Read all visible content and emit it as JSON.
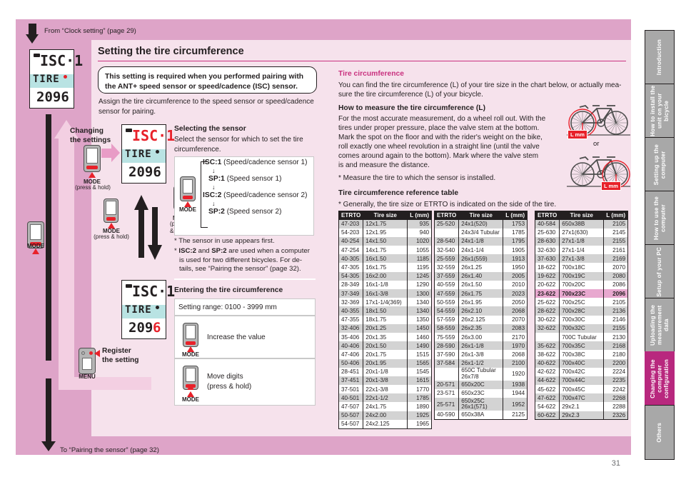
{
  "page": {
    "number": "31"
  },
  "flow": {
    "from_label": "From “Clock setting” (page 29)",
    "to_label": "To “Pairing the sensor” (page 32)",
    "changing_the_settings": "Changing\nthe settings",
    "mode_label": "MODE",
    "menu_label": "MENU",
    "press_hold": "(press & hold)",
    "press_hold_two_line": "(press\n& hold)",
    "register_setting": "Register\nthe setting"
  },
  "lcd": {
    "top_text": "ISC·1",
    "mid_text": "TIRE",
    "value": "2096",
    "value_head": "209",
    "value_tail": "6"
  },
  "main": {
    "title": "Setting the tire circumference",
    "callout": "This setting is required when you performed pairing with the ANT+ speed sensor or speed/cadence (ISC) sensor.",
    "intro": "Assign the tire circumference to the speed sensor or speed/cadence sensor for pairing."
  },
  "selecting_sensor": {
    "heading": "Selecting the sensor",
    "desc": "Select the sensor for which to set the tire circumference.",
    "items": [
      {
        "code": "ISC:1",
        "desc": "(Speed/cadence sensor 1)"
      },
      {
        "code": "SP:1",
        "desc": "(Speed sensor 1)"
      },
      {
        "code": "ISC:2",
        "desc": "(Speed/cadence sensor 2)"
      },
      {
        "code": "SP:2",
        "desc": "(Speed sensor 2)"
      }
    ],
    "note1": "* The sensor in use appears first.",
    "note2": "* ISC:2 and SP:2 are used when a computer is used for two different bicycles. For de-tails, see “Pairing the sensor” (page 32).",
    "note2_parts": {
      "a": "* ",
      "b": "ISC:2",
      "c": " and ",
      "d": "SP:2",
      "e": " are used when a computer"
    },
    "note2_line2": "is used for two different bicycles. For de-",
    "note2_line3": "tails, see “Pairing the sensor” (page 32)."
  },
  "entering": {
    "heading": "Entering the tire circumference",
    "range": "Setting range: 0100 - 3999 mm",
    "rows": [
      {
        "label": "Increase the value",
        "button": "MODE"
      },
      {
        "label": "Move digits\n(press & hold)",
        "button": "MODE"
      }
    ]
  },
  "right_col": {
    "h1": "Tire circumference",
    "p1_l1": "You can find the tire circumference (L) of your tire size in the chart below, or actually mea-",
    "p1_l2": "sure the tire circumference (L) of your bicycle.",
    "h2": "How to measure the tire circumference (L)",
    "p2_l1": "For the most accurate measurement, do a wheel roll out. With the",
    "p2_l2": "tires under proper pressure, place the valve stem at the bottom.",
    "p2_l3": "Mark the spot on the floor and with the rider's weight on the bike,",
    "p2_l4": "roll exactly one wheel revolution in a straight line (until the valve",
    "p2_l5": "comes around again to the bottom). Mark where the valve stem",
    "p2_l6": "is and measure the distance.",
    "p3": "* Measure the tire to which the sensor is installed.",
    "h3": "Tire circumference reference table",
    "p4": "* Generally, the tire size or ETRTO is indicated on the side of the tire.",
    "or": "or",
    "lmm": "L mm"
  },
  "table": {
    "headers": [
      "ETRTO",
      "Tire size",
      "L (mm)"
    ],
    "highlight_row": "23-622",
    "col1": [
      [
        "47-203",
        "12x1.75",
        "935"
      ],
      [
        "54-203",
        "12x1.95",
        "940"
      ],
      [
        "40-254",
        "14x1.50",
        "1020"
      ],
      [
        "47-254",
        "14x1.75",
        "1055"
      ],
      [
        "40-305",
        "16x1.50",
        "1185"
      ],
      [
        "47-305",
        "16x1.75",
        "1195"
      ],
      [
        "54-305",
        "16x2.00",
        "1245"
      ],
      [
        "28-349",
        "16x1-1/8",
        "1290"
      ],
      [
        "37-349",
        "16x1-3/8",
        "1300"
      ],
      [
        "32-369",
        "17x1-1/4(369)",
        "1340"
      ],
      [
        "40-355",
        "18x1.50",
        "1340"
      ],
      [
        "47-355",
        "18x1.75",
        "1350"
      ],
      [
        "32-406",
        "20x1.25",
        "1450"
      ],
      [
        "35-406",
        "20x1.35",
        "1460"
      ],
      [
        "40-406",
        "20x1.50",
        "1490"
      ],
      [
        "47-406",
        "20x1.75",
        "1515"
      ],
      [
        "50-406",
        "20x1.95",
        "1565"
      ],
      [
        "28-451",
        "20x1-1/8",
        "1545"
      ],
      [
        "37-451",
        "20x1-3/8",
        "1615"
      ],
      [
        "37-501",
        "22x1-3/8",
        "1770"
      ],
      [
        "40-501",
        "22x1-1/2",
        "1785"
      ],
      [
        "47-507",
        "24x1.75",
        "1890"
      ],
      [
        "50-507",
        "24x2.00",
        "1925"
      ],
      [
        "54-507",
        "24x2.125",
        "1965"
      ]
    ],
    "col2": [
      [
        "25-520",
        "24x1(520)",
        "1753"
      ],
      [
        "",
        "24x3/4 Tubular",
        "1785"
      ],
      [
        "28-540",
        "24x1-1/8",
        "1795"
      ],
      [
        "32-540",
        "24x1-1/4",
        "1905"
      ],
      [
        "25-559",
        "26x1(559)",
        "1913"
      ],
      [
        "32-559",
        "26x1.25",
        "1950"
      ],
      [
        "37-559",
        "26x1.40",
        "2005"
      ],
      [
        "40-559",
        "26x1.50",
        "2010"
      ],
      [
        "47-559",
        "26x1.75",
        "2023"
      ],
      [
        "50-559",
        "26x1.95",
        "2050"
      ],
      [
        "54-559",
        "26x2.10",
        "2068"
      ],
      [
        "57-559",
        "26x2.125",
        "2070"
      ],
      [
        "58-559",
        "26x2.35",
        "2083"
      ],
      [
        "75-559",
        "26x3.00",
        "2170"
      ],
      [
        "28-590",
        "26x1-1/8",
        "1970"
      ],
      [
        "37-590",
        "26x1-3/8",
        "2068"
      ],
      [
        "37-584",
        "26x1-1/2",
        "2100"
      ],
      [
        "",
        "650C Tubular\n26x7/8",
        "1920"
      ],
      [
        "20-571",
        "650x20C",
        "1938"
      ],
      [
        "23-571",
        "650x23C",
        "1944"
      ],
      [
        "25-571",
        "650x25C\n26x1(571)",
        "1952"
      ],
      [
        "40-590",
        "650x38A",
        "2125"
      ]
    ],
    "col3": [
      [
        "40-584",
        "650x38B",
        "2105"
      ],
      [
        "25-630",
        "27x1(630)",
        "2145"
      ],
      [
        "28-630",
        "27x1-1/8",
        "2155"
      ],
      [
        "32-630",
        "27x1-1/4",
        "2161"
      ],
      [
        "37-630",
        "27x1-3/8",
        "2169"
      ],
      [
        "18-622",
        "700x18C",
        "2070"
      ],
      [
        "19-622",
        "700x19C",
        "2080"
      ],
      [
        "20-622",
        "700x20C",
        "2086"
      ],
      [
        "23-622",
        "700x23C",
        "2096"
      ],
      [
        "25-622",
        "700x25C",
        "2105"
      ],
      [
        "28-622",
        "700x28C",
        "2136"
      ],
      [
        "30-622",
        "700x30C",
        "2146"
      ],
      [
        "32-622",
        "700x32C",
        "2155"
      ],
      [
        "",
        "700C Tubular",
        "2130"
      ],
      [
        "35-622",
        "700x35C",
        "2168"
      ],
      [
        "38-622",
        "700x38C",
        "2180"
      ],
      [
        "40-622",
        "700x40C",
        "2200"
      ],
      [
        "42-622",
        "700x42C",
        "2224"
      ],
      [
        "44-622",
        "700x44C",
        "2235"
      ],
      [
        "45-622",
        "700x45C",
        "2242"
      ],
      [
        "47-622",
        "700x47C",
        "2268"
      ],
      [
        "54-622",
        "29x2.1",
        "2288"
      ],
      [
        "60-622",
        "29x2.3",
        "2326"
      ]
    ]
  },
  "index_tabs": [
    {
      "label": "Introduction",
      "active": false
    },
    {
      "label": "How to install the\nunit on your bicycle",
      "active": false
    },
    {
      "label": "Setting up the\ncomputer",
      "active": false
    },
    {
      "label": "How to use the\ncomputer",
      "active": false
    },
    {
      "label": "Setup of your PC",
      "active": false
    },
    {
      "label": "Uploading the\nmeasurement data",
      "active": false
    },
    {
      "label": "Changing the\ncomputer\nconfiguration",
      "active": true
    },
    {
      "label": "Others",
      "active": false
    }
  ],
  "colors": {
    "pink_panel": "#dea4c8",
    "light_panel": "#f6e2ec",
    "magenta": "#c9317f",
    "active_tab": "#b8287e",
    "red": "#e8212a",
    "lcd_band": "#b9e3e3"
  }
}
